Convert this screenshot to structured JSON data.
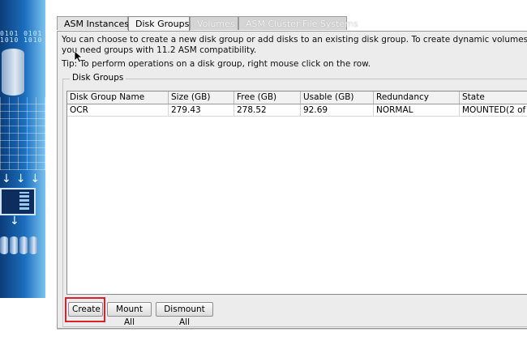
{
  "tabs": [
    {
      "label": "ASM Instances",
      "state": "normal"
    },
    {
      "label": "Disk Groups",
      "state": "active"
    },
    {
      "label": "Volumes",
      "state": "disabled"
    },
    {
      "label": "ASM Cluster File Systems",
      "state": "disabled"
    }
  ],
  "intro_text": "You can choose to create a new disk group or add disks to an existing disk group. To create dynamic volumes, you need groups with 11.2 ASM compatibility.",
  "tip_text": "Tip: To perform operations on a disk group, right mouse click on the row.",
  "group_title": "Disk Groups",
  "side_art": {
    "binary": "0101 0101\n1010 1010"
  },
  "table": {
    "columns": [
      "Disk Group Name",
      "Size (GB)",
      "Free (GB)",
      "Usable (GB)",
      "Redundancy",
      "State"
    ],
    "rows": [
      [
        "OCR",
        "279.43",
        "278.52",
        "92.69",
        "NORMAL",
        "MOUNTED(2 of"
      ]
    ]
  },
  "buttons": {
    "create": "Create",
    "mount_all": "Mount All",
    "dismount_all": "Dismount All"
  },
  "colors": {
    "highlight": "#d8232a",
    "panel_bg": "#ececec"
  }
}
